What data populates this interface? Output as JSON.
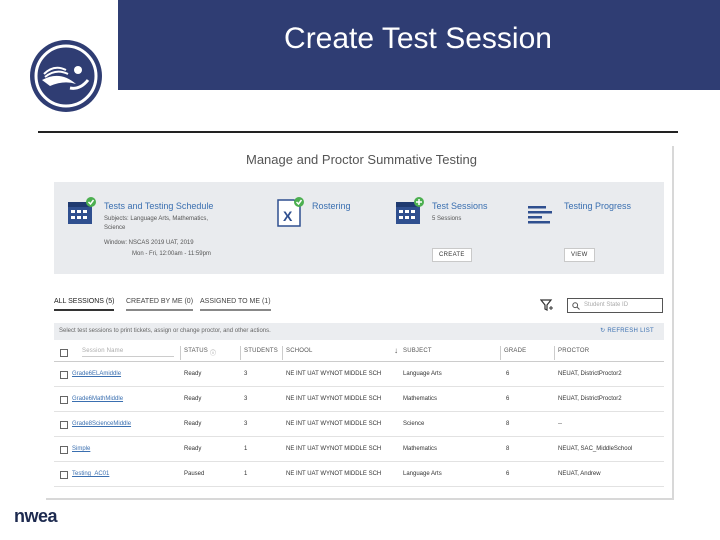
{
  "slide": {
    "title": "Create Test Session",
    "brand": "nwea"
  },
  "app": {
    "page_title": "Manage and Proctor Summative Testing",
    "tiles": [
      {
        "name": "Tests and Testing Schedule",
        "subjects": "Subjects: Language Arts, Mathematics, Science",
        "window": "Window: NSCAS 2019 UAT, 2019",
        "hours": "Mon - Fri, 12:00am - 11:59pm",
        "icon": "calendar-icon",
        "badge": "check"
      },
      {
        "name": "Rostering",
        "icon": "excel-icon",
        "badge": "check"
      },
      {
        "name": "Test Sessions",
        "subtitle": "5 Sessions",
        "button": "CREATE",
        "icon": "calendar-icon",
        "badge": "plus"
      },
      {
        "name": "Testing Progress",
        "button": "VIEW",
        "icon": "progress-lines-icon"
      }
    ],
    "tabs": [
      "ALL SESSIONS (5)",
      "CREATED BY ME (0)",
      "ASSIGNED TO ME (1)"
    ],
    "search_placeholder": "Student State ID",
    "info_text": "Select test sessions to print tickets, assign or change proctor, and other actions.",
    "refresh_label": "REFRESH LIST",
    "table": {
      "headers": {
        "session": "Session Name",
        "status": "STATUS",
        "students": "STUDENTS",
        "school": "SCHOOL",
        "subject": "SUBJECT",
        "grade": "GRADE",
        "proctor": "PROCTOR"
      },
      "rows": [
        {
          "session": "Grade6ELAmiddle",
          "status": "Ready",
          "students": "3",
          "school": "NE INT UAT WYNOT MIDDLE SCH",
          "subject": "Language Arts",
          "grade": "6",
          "proctor": "NEUAT, DistrictProctor2"
        },
        {
          "session": "Grade6MathMiddle",
          "status": "Ready",
          "students": "3",
          "school": "NE INT UAT WYNOT MIDDLE SCH",
          "subject": "Mathematics",
          "grade": "6",
          "proctor": "NEUAT, DistrictProctor2"
        },
        {
          "session": "Grade8ScienceMiddle",
          "status": "Ready",
          "students": "3",
          "school": "NE INT UAT WYNOT MIDDLE SCH",
          "subject": "Science",
          "grade": "8",
          "proctor": "--"
        },
        {
          "session": "Simple",
          "status": "Ready",
          "students": "1",
          "school": "NE INT UAT WYNOT MIDDLE SCH",
          "subject": "Mathematics",
          "grade": "8",
          "proctor": "NEUAT, SAC_MiddleSchool"
        },
        {
          "session": "Testing_AC01",
          "status": "Paused",
          "students": "1",
          "school": "NE INT UAT WYNOT MIDDLE SCH",
          "subject": "Language Arts",
          "grade": "6",
          "proctor": "NEUAT, Andrew"
        }
      ]
    }
  },
  "colors": {
    "header_bg": "#2f3d73",
    "link": "#3a6fb0",
    "check_green": "#4caf50",
    "tile_bg": "#e9ebee"
  }
}
